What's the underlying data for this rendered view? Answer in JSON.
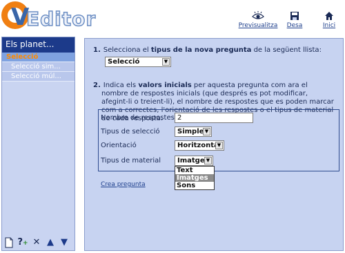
{
  "header": {
    "logo_text": "QVEditor",
    "tools": [
      {
        "label": "Previsualitza",
        "icon": "eye-icon"
      },
      {
        "label": "Desa",
        "icon": "floppy-disk-icon"
      },
      {
        "label": "Inici",
        "icon": "home-icon"
      }
    ]
  },
  "sidebar": {
    "title": "Els planet...",
    "items": [
      {
        "label": "Selecció",
        "state": "active"
      },
      {
        "label": "Selecció sim..."
      },
      {
        "label": "Selecció múl..."
      }
    ],
    "toolbar_icons": [
      "new-page-icon",
      "help-add-icon",
      "delete-x-icon",
      "move-up-icon",
      "move-down-icon"
    ]
  },
  "main": {
    "q1": {
      "num": "1.",
      "text_before": "Selecciona el ",
      "text_bold": "tipus de la nova pregunta",
      "text_after": " de la següent llista:",
      "select_value": "Selecció"
    },
    "q2": {
      "num": "2.",
      "text_before": "Indica els ",
      "text_bold": "valors inicials",
      "text_after": " per aquesta pregunta com ara el nombre de respostes inicials (que després es pot modificar, afegint-li o treient-li), el nombre de respostes que es poden marcar com a correctes, l'orientació de les respostes o el tipus de material de cada resposta."
    },
    "fields": {
      "count_label": "Nombre de respostes",
      "count_value": "2",
      "seltype_label": "Tipus de selecció",
      "seltype_value": "Simple",
      "orient_label": "Orientació",
      "orient_value": "Horitzontal",
      "material_label": "Tipus de material",
      "material_value": "Imatges",
      "material_options": [
        "Text",
        "Imatges",
        "Sons"
      ],
      "material_highlighted": "Imatges"
    },
    "create_link": "Crea pregunta"
  },
  "colors": {
    "panel_bg": "#c7d3f1",
    "title_bar": "#1c3a8a",
    "accent_orange": "#f07f12",
    "link_blue": "#1e3f8c"
  }
}
